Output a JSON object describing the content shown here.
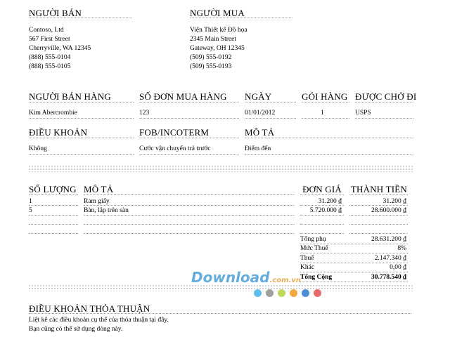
{
  "seller": {
    "heading": "NGƯỜI BÁN",
    "lines": [
      "Contoso, Ltd",
      "567 First Street",
      "Cherryville, WA 12345",
      "(888) 555-0104",
      "(888) 555-0105"
    ]
  },
  "buyer": {
    "heading": "NGƯỜI MUA",
    "lines": [
      "Viện Thiết kế Đồ họa",
      "2345 Main Street",
      "Gateway, OH 12345",
      "(509) 555-0192",
      "(509) 555-0193"
    ]
  },
  "order_info": {
    "headers": [
      "NGƯỜI BÁN HÀNG",
      "SỐ ĐƠN MUA HÀNG",
      "NGÀY",
      "GÓI HÀNG",
      "ĐƯỢC CHỞ ĐI"
    ],
    "values": [
      "Kim Abercrombie",
      "123",
      "01/01/2012",
      "1",
      "USPS"
    ]
  },
  "terms_info": {
    "headers": [
      "ĐIỀU KHOẢN",
      "FOB/INCOTERM",
      "MÔ TẢ"
    ],
    "values": [
      "Không",
      "Cước vận chuyển trả trước",
      "Điểm đến"
    ]
  },
  "items": {
    "headers": [
      "SỐ LƯỢNG",
      "MÔ TẢ",
      "ĐƠN GIÁ",
      "THÀNH TIỀN"
    ],
    "rows": [
      {
        "qty": "1",
        "desc": "Ram giấy",
        "unit": "31.200 ₫",
        "total": "31.200 ₫"
      },
      {
        "qty": "5",
        "desc": "Bàn, lắp trên sàn",
        "unit": "5.720.000 ₫",
        "total": "28.600.000 ₫"
      }
    ]
  },
  "totals": [
    {
      "label": "Tổng phụ",
      "value": "28.631.200 ₫"
    },
    {
      "label": "Mức Thuế",
      "value": "8%"
    },
    {
      "label": "Thuế",
      "value": "2.147.340 ₫"
    },
    {
      "label": "Khác",
      "value": "0,00 ₫"
    },
    {
      "label": "Tổng Cộng",
      "value": "30.778.540 ₫"
    }
  ],
  "agreement": {
    "heading": "ĐIỀU KHOẢN THỎA THUẬN",
    "lines": [
      "Liệt kê các điều khoản cụ thể của thỏa thuận tại đây.",
      "Bạn cũng có thể sử dụng dòng này."
    ]
  },
  "watermark": {
    "text_main": "Download",
    "text_dot": ".com.vn",
    "dot_colors": [
      "#5bc0eb",
      "#a0a0a0",
      "#bcd95a",
      "#f5a742",
      "#4a8fd8",
      "#e86a6a"
    ]
  }
}
